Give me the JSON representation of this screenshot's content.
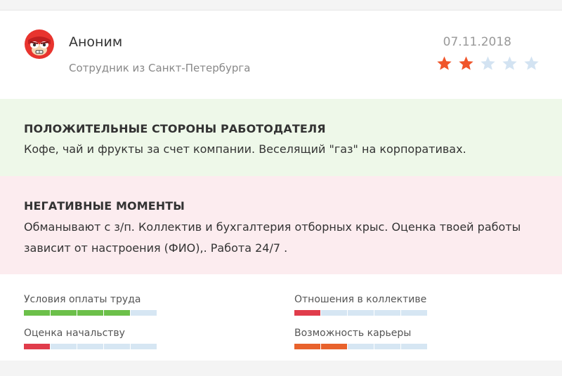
{
  "review": {
    "author": "Аноним",
    "location": "Сотрудник из Санкт-Петербурга",
    "date": "07.11.2018",
    "rating": 2,
    "rating_max": 5
  },
  "positive": {
    "title": "ПОЛОЖИТЕЛЬНЫЕ СТОРОНЫ РАБОТОДАТЕЛЯ",
    "text": "Кофе, чай и фрукты за счет компании. Веселящий \"газ\" на корпоративах."
  },
  "negative": {
    "title": "НЕГАТИВНЫЕ МОМЕНТЫ",
    "text": "Обманывают с з/п. Коллектив и бухгалтерия отборных крыс. Оценка твоей работы зависит от настроения (ФИО),. Работа 24/7 ."
  },
  "metrics": [
    {
      "label": "Условия оплаты труда",
      "score": 4,
      "max": 5,
      "color": "#6cc04a"
    },
    {
      "label": "Отношения в коллективе",
      "score": 1,
      "max": 5,
      "color": "#e03c4b"
    },
    {
      "label": "Оценка начальству",
      "score": 1,
      "max": 5,
      "color": "#e03c4b"
    },
    {
      "label": "Возможность карьеры",
      "score": 2,
      "max": 5,
      "color": "#e8622c"
    }
  ],
  "colors": {
    "star_active": "#f0552a",
    "star_inactive": "#d3e3f2",
    "bar_empty": "#d6e6f3"
  },
  "icons": {
    "avatar": "masked-luchador-avatar",
    "star": "star-icon"
  }
}
